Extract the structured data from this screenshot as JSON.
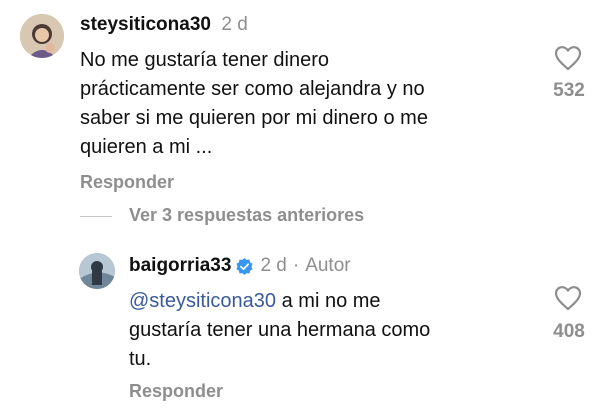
{
  "comments": [
    {
      "username": "steysiticona30",
      "time": "2 d",
      "text": "No me gustaría tener dinero prácticamente ser como alejandra y no saber si me quieren por mi dinero o me quieren a mi ...",
      "text_lines": [
        "No me gustaría tener dinero",
        "prácticamente ser como alejandra y no",
        "saber si me quieren por mi dinero o me",
        "quieren a mi ..."
      ],
      "reply_label": "Responder",
      "like_count": "532"
    }
  ],
  "view_replies_label": "Ver 3 respuestas anteriores",
  "reply": {
    "username": "baigorria33",
    "time": "2 d",
    "separator": "·",
    "author_badge": "Autor",
    "mention": "@steysiticona30",
    "text_lines": [
      " a mi no me",
      "gustaría tener una hermana como",
      "tu."
    ],
    "reply_label": "Responder",
    "like_count": "408"
  },
  "icons": {
    "like": "heart-icon",
    "verified": "verified-badge-icon"
  },
  "colors": {
    "mention": "#3a5a9b",
    "muted": "#8e8e8e",
    "verified": "#3797f0"
  }
}
